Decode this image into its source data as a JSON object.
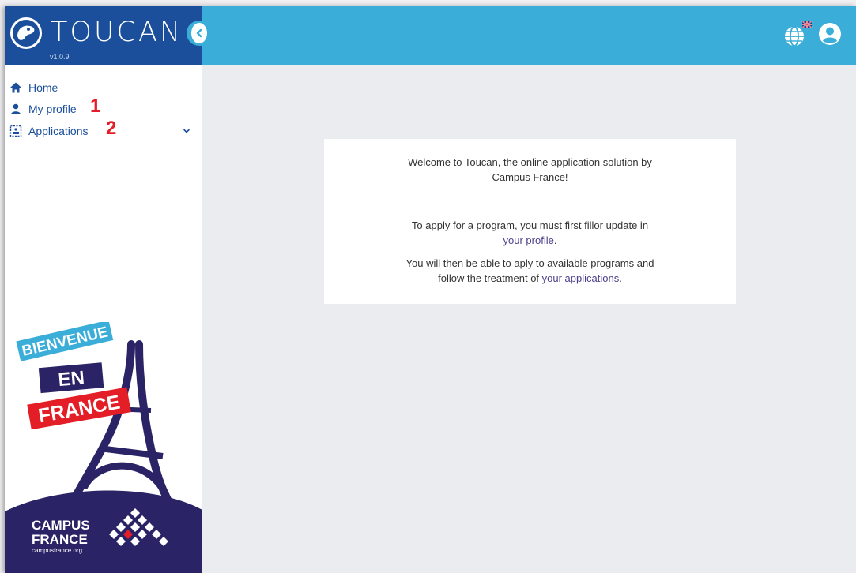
{
  "app": {
    "name": "TOUCAN",
    "version": "v1.0.9"
  },
  "sidebar": {
    "items": [
      {
        "label": "Home",
        "icon": "home-icon"
      },
      {
        "label": "My profile",
        "icon": "person-icon",
        "marker": "1"
      },
      {
        "label": "Applications",
        "icon": "applications-icon",
        "marker": "2"
      }
    ]
  },
  "promo": {
    "line1": "BIENVENUE",
    "line2": "EN",
    "line3": "FRANCE",
    "logo_line1": "CAMPUS",
    "logo_line2": "FRANCE",
    "logo_url": "campusfrance.org"
  },
  "welcome": {
    "line1": "Welcome to Toucan, the online application solution by",
    "line2": "Campus France!",
    "apply_line": "To apply for a program, you must first fillor update in",
    "profile_link": "your profile",
    "then_line": "You will then be able to aply to available programs and",
    "follow_prefix": "follow the treatment of ",
    "applications_link": "your applications",
    "period": "."
  },
  "colors": {
    "header": "#3aaed8",
    "brand": "#1b4f9b",
    "background": "#ebecef",
    "marker": "#e41e26"
  }
}
